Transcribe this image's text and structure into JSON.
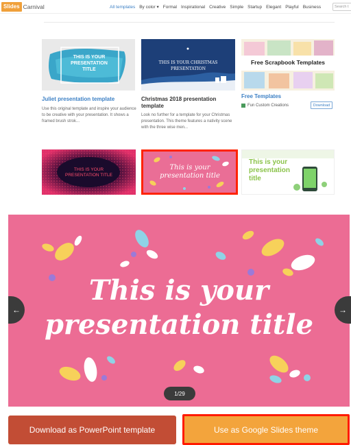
{
  "header": {
    "logo_mark": "Slides",
    "logo_word": "Carnival",
    "nav": [
      "All templates",
      "By color ▾",
      "Formal",
      "Inspirational",
      "Creative",
      "Simple",
      "Startup",
      "Elegant",
      "Playful",
      "Business"
    ],
    "search_placeholder": "Search t"
  },
  "cards": [
    {
      "thumb_text": "THIS IS YOUR PRESENTATION TITLE",
      "title": "Juliet presentation template",
      "desc": "Use this original template and inspire your audience to be creative with your presentation. It shows a framed brush strok...",
      "title_color": "#3b7fc4"
    },
    {
      "thumb_text": "THIS IS YOUR CHRISTMAS PRESENTATION",
      "title": "Christmas 2018 presentation template",
      "desc": "Look no further for a template for your Christmas presentation. This theme features a nativity scene with the three wise men...",
      "title_color": "#333333"
    },
    {
      "thumb_text": "Free Scrapbook Templates",
      "title": "Free Templates",
      "desc": "Fun Custom Creations",
      "button": "Download",
      "title_color": "#3b7fc4"
    },
    {
      "thumb_text": "THIS IS YOUR PRESENTATION TITLE"
    },
    {
      "thumb_text": "This is your presentation title"
    },
    {
      "thumb_text": "This is your presentation title"
    }
  ],
  "preview": {
    "title_line1": "This is your",
    "title_line2": "presentation title",
    "counter": "1/29",
    "prev_arrow": "←",
    "next_arrow": "→"
  },
  "buttons": {
    "ppt": "Download as PowerPoint template",
    "gslides": "Use as Google Slides theme"
  }
}
